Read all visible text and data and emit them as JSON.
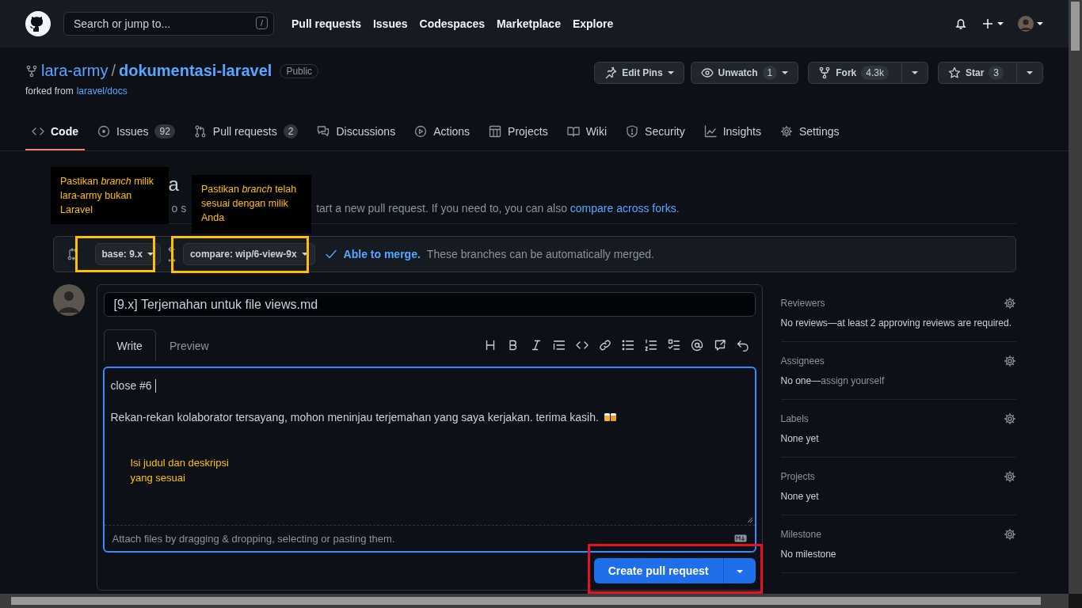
{
  "header": {
    "search_placeholder": "Search or jump to...",
    "search_key": "/",
    "nav": [
      "Pull requests",
      "Issues",
      "Codespaces",
      "Marketplace",
      "Explore"
    ]
  },
  "repo": {
    "owner": "lara-army",
    "separator": "/",
    "name": "dokumentasi-laravel",
    "visibility": "Public",
    "forked_prefix": "forked from",
    "forked_link": "laravel/docs",
    "actions": [
      {
        "kind": "menu",
        "label": "Edit Pins"
      },
      {
        "kind": "menu",
        "label": "Unwatch",
        "count": "1"
      },
      {
        "kind": "split",
        "label": "Fork",
        "count": "4.3k"
      },
      {
        "kind": "split",
        "label": "Star",
        "count": "3"
      }
    ]
  },
  "tabs": [
    {
      "label": "Code",
      "selected": true
    },
    {
      "label": "Issues",
      "count": "92",
      "selected": false
    },
    {
      "label": "Pull requests",
      "count": "2",
      "selected": false
    },
    {
      "label": "Discussions",
      "selected": false
    },
    {
      "label": "Actions",
      "selected": false
    },
    {
      "label": "Projects",
      "selected": false
    },
    {
      "label": "Wiki",
      "selected": false
    },
    {
      "label": "Security",
      "selected": false
    },
    {
      "label": "Insights",
      "selected": false
    },
    {
      "label": "Settings",
      "selected": false
    }
  ],
  "compare": {
    "heading_fragment": "a",
    "description_fragment": "o s",
    "description": "tart a new pull request. If you need to, you can also",
    "description_link": "compare across forks",
    "description_end": ".",
    "base": "base: 9.x",
    "compare": "compare: wip/6-view-9x",
    "merge_status": "Able to merge.",
    "merge_note": "These branches can be automatically merged."
  },
  "form": {
    "title_value": "[9.x] Terjemahan untuk file views.md",
    "tabs": [
      {
        "label": "Write",
        "selected": true
      },
      {
        "label": "Preview",
        "selected": false
      }
    ],
    "body_lines": [
      "close #6",
      "Rekan-rekan kolaborator tersayang, mohon meninjau terjemahan yang saya kerjakan. terima kasih."
    ],
    "attach_note": "Attach files by dragging & dropping, selecting or pasting them.",
    "submit": "Create pull request"
  },
  "sidebar": [
    {
      "title": "Reviewers",
      "value": "No reviews—at least 2 approving reviews are required."
    },
    {
      "title": "Assignees",
      "value": "No one—",
      "value_link": "assign yourself"
    },
    {
      "title": "Labels",
      "value": "None yet"
    },
    {
      "title": "Projects",
      "value": "None yet"
    },
    {
      "title": "Milestone",
      "value": "No milestone"
    }
  ],
  "annotations": [
    {
      "kind": "callout",
      "text": "Pastikan *branch* milik lara-army bukan Laravel"
    },
    {
      "kind": "callout",
      "text": "Pastikan *branch* telah sesuai dengan milik Anda"
    },
    {
      "kind": "note",
      "text": "Isi judul dan deskripsi yang sesuai"
    }
  ],
  "highlights": [
    {
      "color": "#ffc000"
    },
    {
      "color": "#ffc000"
    },
    {
      "color": "#e81123"
    }
  ]
}
